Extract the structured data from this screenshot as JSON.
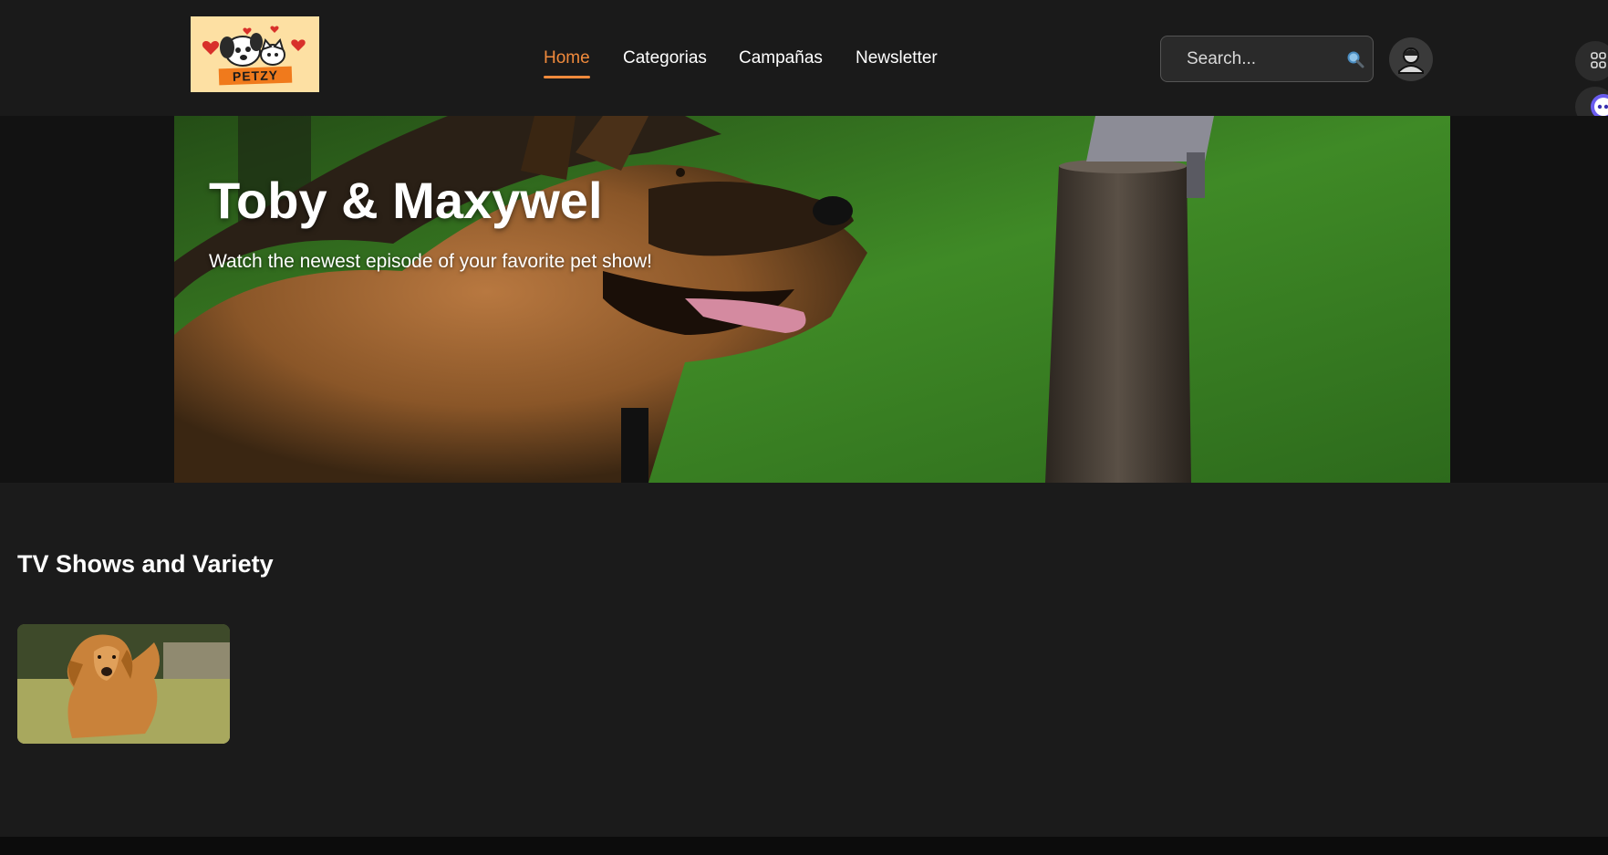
{
  "header": {
    "logo_text": "PETZY",
    "nav": [
      {
        "label": "Home",
        "active": true
      },
      {
        "label": "Categorias",
        "active": false
      },
      {
        "label": "Campañas",
        "active": false
      },
      {
        "label": "Newsletter",
        "active": false
      }
    ],
    "search": {
      "placeholder": "Search...",
      "icon": "search-icon"
    },
    "avatar_icon": "user-icon"
  },
  "side_tools": [
    {
      "icon": "apps-grid-icon"
    },
    {
      "icon": "assistant-bot-icon"
    },
    {
      "icon": "translate-icon"
    }
  ],
  "hero": {
    "title": "Toby & Maxywel",
    "subtitle": "Watch the newest episode of your favorite pet show!"
  },
  "section": {
    "title": "TV Shows and Variety",
    "cards": [
      {
        "image": "golden-retriever-running-thumbnail"
      }
    ]
  },
  "colors": {
    "background": "#1b1b1b",
    "accent": "#f08a3c",
    "nav_text": "#ffffff"
  }
}
